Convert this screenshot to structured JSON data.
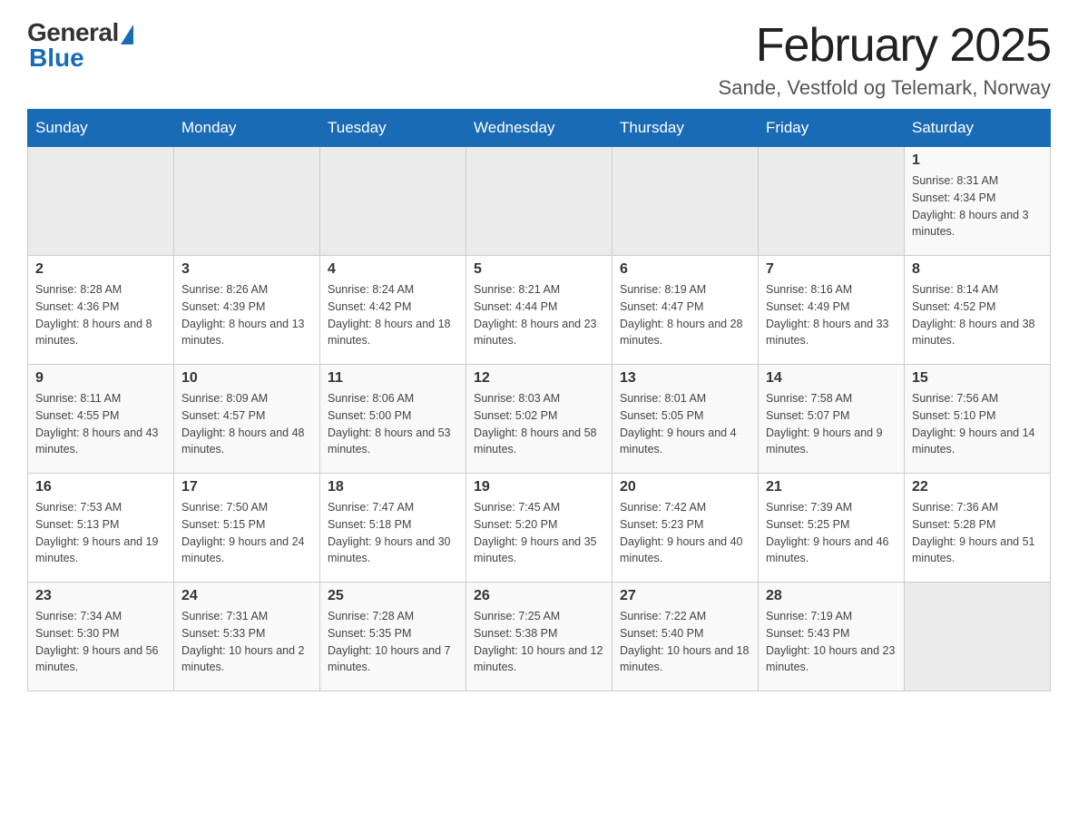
{
  "header": {
    "logo": {
      "general": "General",
      "blue": "Blue"
    },
    "title": "February 2025",
    "location": "Sande, Vestfold og Telemark, Norway"
  },
  "calendar": {
    "days_of_week": [
      "Sunday",
      "Monday",
      "Tuesday",
      "Wednesday",
      "Thursday",
      "Friday",
      "Saturday"
    ],
    "weeks": [
      {
        "days": [
          {
            "date": "",
            "info": ""
          },
          {
            "date": "",
            "info": ""
          },
          {
            "date": "",
            "info": ""
          },
          {
            "date": "",
            "info": ""
          },
          {
            "date": "",
            "info": ""
          },
          {
            "date": "",
            "info": ""
          },
          {
            "date": "1",
            "info": "Sunrise: 8:31 AM\nSunset: 4:34 PM\nDaylight: 8 hours and 3 minutes."
          }
        ]
      },
      {
        "days": [
          {
            "date": "2",
            "info": "Sunrise: 8:28 AM\nSunset: 4:36 PM\nDaylight: 8 hours and 8 minutes."
          },
          {
            "date": "3",
            "info": "Sunrise: 8:26 AM\nSunset: 4:39 PM\nDaylight: 8 hours and 13 minutes."
          },
          {
            "date": "4",
            "info": "Sunrise: 8:24 AM\nSunset: 4:42 PM\nDaylight: 8 hours and 18 minutes."
          },
          {
            "date": "5",
            "info": "Sunrise: 8:21 AM\nSunset: 4:44 PM\nDaylight: 8 hours and 23 minutes."
          },
          {
            "date": "6",
            "info": "Sunrise: 8:19 AM\nSunset: 4:47 PM\nDaylight: 8 hours and 28 minutes."
          },
          {
            "date": "7",
            "info": "Sunrise: 8:16 AM\nSunset: 4:49 PM\nDaylight: 8 hours and 33 minutes."
          },
          {
            "date": "8",
            "info": "Sunrise: 8:14 AM\nSunset: 4:52 PM\nDaylight: 8 hours and 38 minutes."
          }
        ]
      },
      {
        "days": [
          {
            "date": "9",
            "info": "Sunrise: 8:11 AM\nSunset: 4:55 PM\nDaylight: 8 hours and 43 minutes."
          },
          {
            "date": "10",
            "info": "Sunrise: 8:09 AM\nSunset: 4:57 PM\nDaylight: 8 hours and 48 minutes."
          },
          {
            "date": "11",
            "info": "Sunrise: 8:06 AM\nSunset: 5:00 PM\nDaylight: 8 hours and 53 minutes."
          },
          {
            "date": "12",
            "info": "Sunrise: 8:03 AM\nSunset: 5:02 PM\nDaylight: 8 hours and 58 minutes."
          },
          {
            "date": "13",
            "info": "Sunrise: 8:01 AM\nSunset: 5:05 PM\nDaylight: 9 hours and 4 minutes."
          },
          {
            "date": "14",
            "info": "Sunrise: 7:58 AM\nSunset: 5:07 PM\nDaylight: 9 hours and 9 minutes."
          },
          {
            "date": "15",
            "info": "Sunrise: 7:56 AM\nSunset: 5:10 PM\nDaylight: 9 hours and 14 minutes."
          }
        ]
      },
      {
        "days": [
          {
            "date": "16",
            "info": "Sunrise: 7:53 AM\nSunset: 5:13 PM\nDaylight: 9 hours and 19 minutes."
          },
          {
            "date": "17",
            "info": "Sunrise: 7:50 AM\nSunset: 5:15 PM\nDaylight: 9 hours and 24 minutes."
          },
          {
            "date": "18",
            "info": "Sunrise: 7:47 AM\nSunset: 5:18 PM\nDaylight: 9 hours and 30 minutes."
          },
          {
            "date": "19",
            "info": "Sunrise: 7:45 AM\nSunset: 5:20 PM\nDaylight: 9 hours and 35 minutes."
          },
          {
            "date": "20",
            "info": "Sunrise: 7:42 AM\nSunset: 5:23 PM\nDaylight: 9 hours and 40 minutes."
          },
          {
            "date": "21",
            "info": "Sunrise: 7:39 AM\nSunset: 5:25 PM\nDaylight: 9 hours and 46 minutes."
          },
          {
            "date": "22",
            "info": "Sunrise: 7:36 AM\nSunset: 5:28 PM\nDaylight: 9 hours and 51 minutes."
          }
        ]
      },
      {
        "days": [
          {
            "date": "23",
            "info": "Sunrise: 7:34 AM\nSunset: 5:30 PM\nDaylight: 9 hours and 56 minutes."
          },
          {
            "date": "24",
            "info": "Sunrise: 7:31 AM\nSunset: 5:33 PM\nDaylight: 10 hours and 2 minutes."
          },
          {
            "date": "25",
            "info": "Sunrise: 7:28 AM\nSunset: 5:35 PM\nDaylight: 10 hours and 7 minutes."
          },
          {
            "date": "26",
            "info": "Sunrise: 7:25 AM\nSunset: 5:38 PM\nDaylight: 10 hours and 12 minutes."
          },
          {
            "date": "27",
            "info": "Sunrise: 7:22 AM\nSunset: 5:40 PM\nDaylight: 10 hours and 18 minutes."
          },
          {
            "date": "28",
            "info": "Sunrise: 7:19 AM\nSunset: 5:43 PM\nDaylight: 10 hours and 23 minutes."
          },
          {
            "date": "",
            "info": ""
          }
        ]
      }
    ]
  }
}
